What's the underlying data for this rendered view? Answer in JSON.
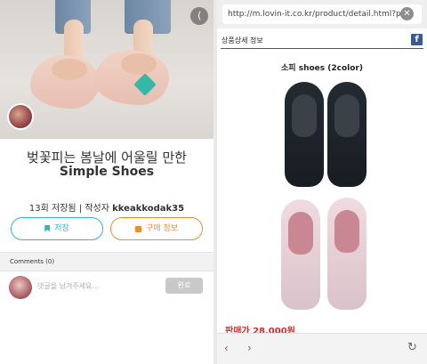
{
  "left": {
    "title_line1": "벚꽃피는 봄날에 어울릴 만한",
    "title_line2": "Simple Shoes",
    "meta_saves": "13회 저장됨 | 작성자",
    "meta_author": "kkeakkodak35",
    "save_label": "저장",
    "buy_label": "구매 정보",
    "comments_header": "Comments (0)",
    "comment_placeholder": "댓글을 남겨주세요...",
    "comment_submit": "완료",
    "share_icon": "share-icon",
    "tag_icon": "tag-icon"
  },
  "right": {
    "url": "http://m.lovin-it.co.kr/product/detail.html?pr",
    "section_title": "상품상세 정보",
    "facebook_glyph": "f",
    "product_title": "소피 shoes (2color)",
    "price": "판매가 28,000원",
    "nav_back": "‹",
    "nav_forward": "›",
    "nav_reload": "↻"
  },
  "colors": {
    "accent_teal": "#2fb6c6",
    "accent_orange": "#f08a2b",
    "price_red": "#d92a2a",
    "facebook_blue": "#3b5998"
  }
}
